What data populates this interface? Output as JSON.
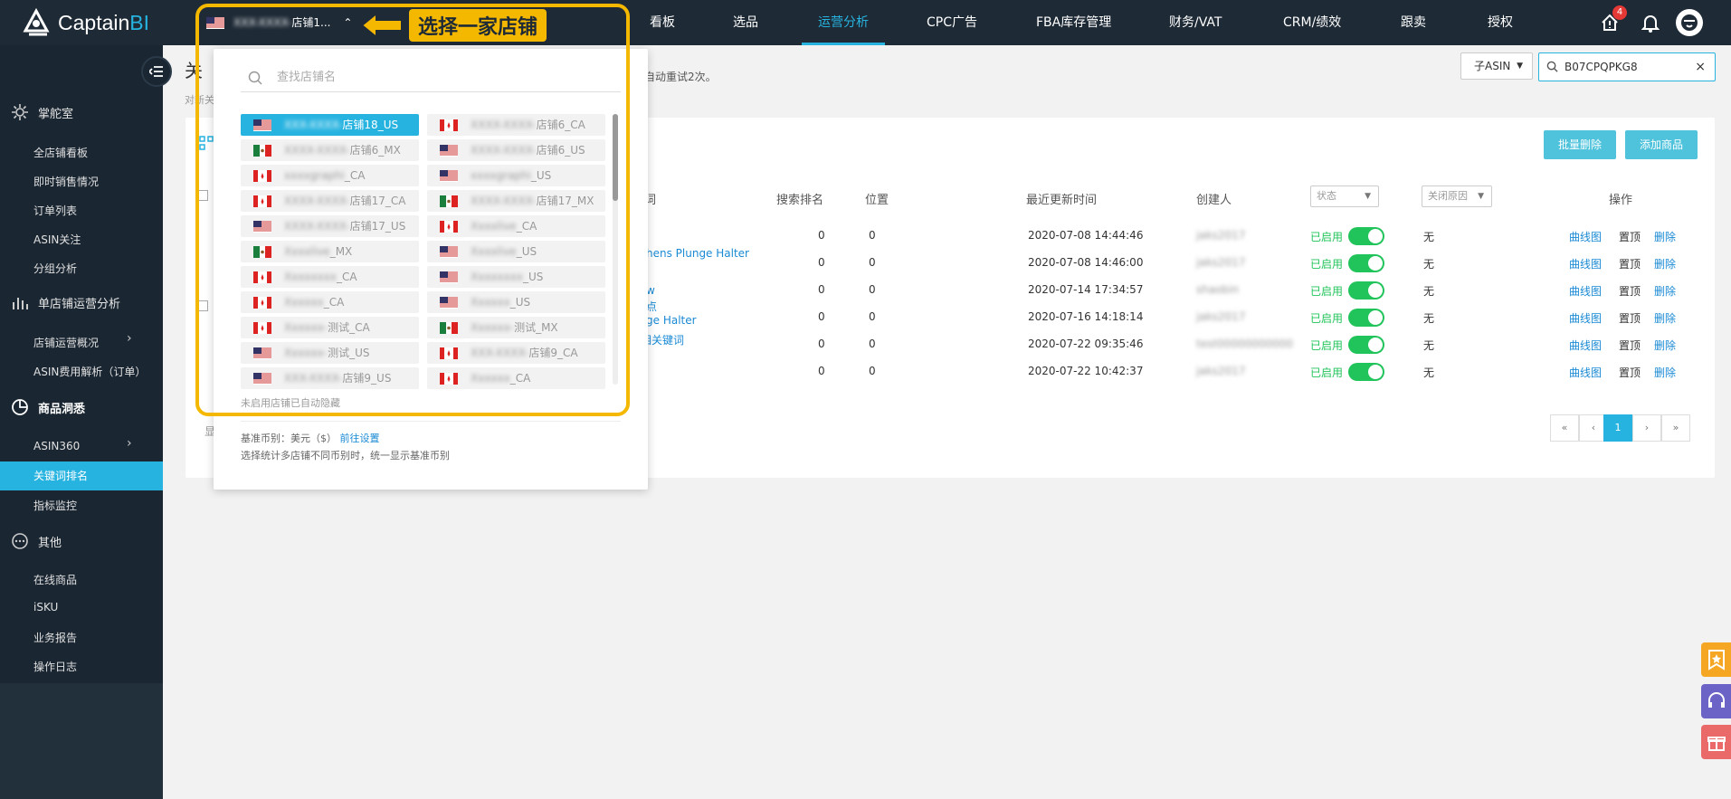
{
  "app": {
    "logo_text": "Captain",
    "logo_accent": "BI"
  },
  "shop_selector": {
    "current": "店铺1...",
    "current_blurred": "XXX-XXXX-"
  },
  "annotation": {
    "label": "选择一家店铺"
  },
  "nav": [
    "看板",
    "选品",
    "运营分析",
    "CPC广告",
    "FBA库存管理",
    "财务/VAT",
    "CRM/绩效",
    "跟卖",
    "授权"
  ],
  "nav_active": "运营分析",
  "notification_count": "4",
  "sidebar": {
    "sections": [
      {
        "label": "掌舵室",
        "icon": "gear-icon",
        "items": [
          "全店铺看板",
          "即时销售情况",
          "订单列表",
          "ASIN关注",
          "分组分析"
        ]
      },
      {
        "label": "单店铺运营分析",
        "icon": "bar-chart-icon",
        "items": [
          "店铺运营概况",
          "ASIN费用解析（订单）"
        ]
      },
      {
        "label": "商品洞悉",
        "icon": "pie-chart-icon",
        "items": [
          "ASIN360",
          "关键词排名",
          "指标监控"
        ]
      },
      {
        "label": "其他",
        "icon": "more-icon",
        "items": [
          "在线商品",
          "iSKU",
          "业务报告",
          "操作日志"
        ]
      }
    ],
    "active_item": "关键词排名"
  },
  "page": {
    "title_partial": "关",
    "desc_partial": "对新关",
    "retry_note": "自动重试2次。",
    "asin_type": "子ASIN",
    "asin_search": "B07CPQPKG8",
    "buttons": {
      "batch_delete": "批量删除",
      "add_product": "添加商品"
    },
    "left_partial": "显",
    "columns": {
      "keyword_partial": "词",
      "search_rank": "搜索排名",
      "position": "位置",
      "updated": "最近更新时间",
      "creator": "创建人",
      "status": "状态",
      "close_reason": "关闭原因",
      "actions": "操作"
    },
    "rows": [
      {
        "keyword": "",
        "rank": "0",
        "pos": "0",
        "updated": "2020-07-08 14:44:46",
        "creator": "jaks2017",
        "status": "已启用",
        "reason": "无"
      },
      {
        "keyword": "hens Plunge Halter",
        "rank": "0",
        "pos": "0",
        "updated": "2020-07-08 14:46:00",
        "creator": "jaks2017",
        "status": "已启用",
        "reason": "无"
      },
      {
        "keyword": "w",
        "keyword2": "点",
        "rank": "0",
        "pos": "0",
        "updated": "2020-07-14 17:34:57",
        "creator": "shaobin",
        "status": "已启用",
        "reason": "无"
      },
      {
        "keyword": "ge Halter",
        "rank": "0",
        "pos": "0",
        "updated": "2020-07-16 14:18:14",
        "creator": "jaks2017",
        "status": "已启用",
        "reason": "无"
      },
      {
        "keyword": "相关键词",
        "rank": "0",
        "pos": "0",
        "updated": "2020-07-22 09:35:46",
        "creator": "test00000000000",
        "status": "已启用",
        "reason": "无"
      },
      {
        "keyword": "",
        "rank": "0",
        "pos": "0",
        "updated": "2020-07-22 10:42:37",
        "creator": "jaks2017",
        "status": "已启用",
        "reason": "无"
      }
    ],
    "actions": {
      "chart": "曲线图",
      "pin": "置顶",
      "delete": "删除"
    },
    "pagination": [
      "«",
      "‹",
      "1",
      "›",
      "»"
    ]
  },
  "dropdown": {
    "search_placeholder": "查找店铺名",
    "stores": [
      {
        "blur": "XXX-XXXX-",
        "name": "店铺18_US",
        "flag": "US",
        "selected": true
      },
      {
        "blur": "XXXX-XXXX-",
        "name": "店铺6_CA",
        "flag": "CA"
      },
      {
        "blur": "XXXX-XXXX-",
        "name": "店铺6_MX",
        "flag": "MX"
      },
      {
        "blur": "XXXX-XXXX-",
        "name": "店铺6_US",
        "flag": "US"
      },
      {
        "blur": "xxxxgraphi",
        "name": "_CA",
        "flag": "CA"
      },
      {
        "blur": "xxxxgraphi",
        "name": "_US",
        "flag": "US"
      },
      {
        "blur": "XXXX-XXXX-",
        "name": "店铺17_CA",
        "flag": "CA"
      },
      {
        "blur": "XXXX-XXXX-",
        "name": "店铺17_MX",
        "flag": "MX"
      },
      {
        "blur": "XXXX-XXXX-",
        "name": "店铺17_US",
        "flag": "US"
      },
      {
        "blur": "Xxxxlive",
        "name": "_CA",
        "flag": "CA"
      },
      {
        "blur": "Xxxxlive",
        "name": "_MX",
        "flag": "MX"
      },
      {
        "blur": "Xxxxlive",
        "name": "_US",
        "flag": "US"
      },
      {
        "blur": "Xxxxxxxx",
        "name": "_CA",
        "flag": "CA"
      },
      {
        "blur": "Xxxxxxxx",
        "name": "_US",
        "flag": "US"
      },
      {
        "blur": "Xxxxxx",
        "name": "_CA",
        "flag": "CA"
      },
      {
        "blur": "Xxxxxx",
        "name": "_US",
        "flag": "US"
      },
      {
        "blur": "Xxxxxx-",
        "name": "测试_CA",
        "flag": "CA"
      },
      {
        "blur": "Xxxxxx-",
        "name": "测试_MX",
        "flag": "MX"
      },
      {
        "blur": "Xxxxxx-",
        "name": "测试_US",
        "flag": "US"
      },
      {
        "blur": "XXX-XXXX-",
        "name": "店铺9_CA",
        "flag": "CA"
      },
      {
        "blur": "XXX-XXXX-",
        "name": "店铺9_US",
        "flag": "US"
      },
      {
        "blur": "Xxxxxx",
        "name": "_CA",
        "flag": "CA"
      }
    ],
    "hidden_note": "未启用店铺已自动隐藏",
    "currency_label": "基准币别：美元（$）",
    "currency_link": "前往设置",
    "currency_note": "选择统计多店铺不同币别时，统一显示基准币别"
  },
  "colors": {
    "accent": "#27b3e0",
    "annotation": "#f5b800",
    "topbar": "#1e2a36",
    "toggle_on": "#21c45a"
  }
}
